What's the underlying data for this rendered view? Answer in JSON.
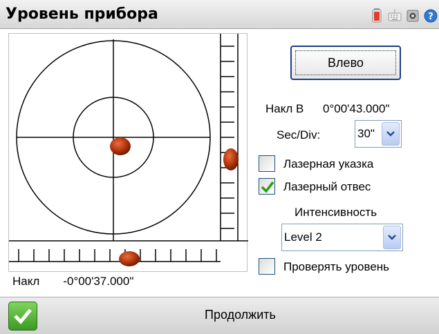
{
  "titlebar": {
    "title": "Уровень прибора",
    "status_icons": [
      "battery-icon",
      "keyboard-icon",
      "module-icon",
      "help-icon"
    ]
  },
  "level": {
    "tilt_label": "Накл",
    "tilt_value": "-0°00'37.000\""
  },
  "controls": {
    "face_button_label": "Влево",
    "tilt_b_label": "Накл В",
    "tilt_b_value": "0°00'43.000\"",
    "sec_div_label": "Sec/Div:",
    "sec_div_value": "30\"",
    "laser_pointer_label": "Лазерная указка",
    "laser_pointer_checked": false,
    "laser_plummet_label": "Лазерный отвес",
    "laser_plummet_checked": true,
    "intensity_label": "Интенсивность",
    "intensity_value": "Level 2",
    "check_level_label": "Проверять уровень",
    "check_level_checked": false
  },
  "footer": {
    "continue_label": "Продолжить"
  },
  "colors": {
    "bubble": "#b3360e",
    "checkmark": "#2f9a1a",
    "button_border": "#1a3d88"
  }
}
